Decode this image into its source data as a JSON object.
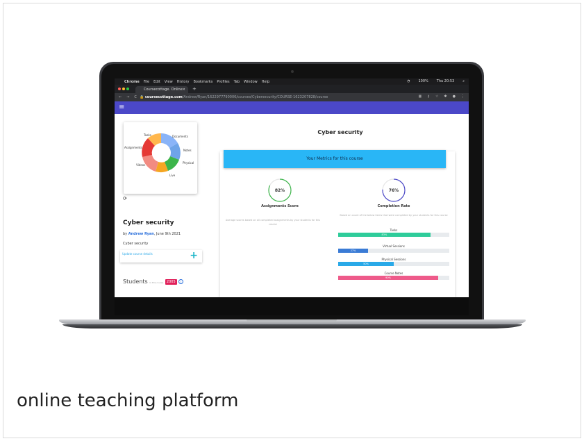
{
  "caption": "online teaching platform",
  "menubar": {
    "app": "Chrome",
    "items": [
      "File",
      "Edit",
      "View",
      "History",
      "Bookmarks",
      "Profiles",
      "Tab",
      "Window",
      "Help"
    ],
    "battery": "100%",
    "clock": "Thu 20:53"
  },
  "tab": {
    "title": "Coursecottage. Online teachi",
    "close": "×",
    "new": "+"
  },
  "url": {
    "host": "coursecottage.com",
    "path": "/Andrew/Ryan/1622977790006/courses/Cybersecurity/COURSE-1623207828/course"
  },
  "sidebar": {
    "chart_labels": [
      "Tasks",
      "Documents",
      "Assignments",
      "Notes",
      "Physical",
      "Videos",
      "Live"
    ],
    "course_title": "Cyber security",
    "by": "by",
    "author": "Andrew Ryan",
    "date": ", June 9th 2021",
    "subtitle": "Cyber security",
    "update_link": "Update course details",
    "plus": "+",
    "students_label": "Students",
    "students_small": "in this course",
    "students_count": "2005",
    "info": "i",
    "refresh": "⟳"
  },
  "main": {
    "title": "Cyber security",
    "banner": "Your Metrics for this course",
    "assignments": {
      "value_text": "82%",
      "value": 0.82,
      "label": "Assignments Score",
      "desc": "Average scores based on all completed assignments by your students for this course",
      "color": "#3cb54a"
    },
    "completion": {
      "value_text": "76%",
      "value": 0.76,
      "label": "Completion Rate",
      "desc": "Based on count of the below items that were completed by your students for this course",
      "color": "#4b48c8"
    },
    "bars": [
      {
        "label": "Tasks",
        "text": "83%",
        "value": 0.83,
        "color": "#2ecc9a"
      },
      {
        "label": "Virtual Sessions",
        "text": "27%",
        "value": 0.27,
        "color": "#3a7bd5"
      },
      {
        "label": "Physical Sessions",
        "text": "50%",
        "value": 0.5,
        "color": "#29a9e8"
      },
      {
        "label": "Course Notes",
        "text": "90%",
        "value": 0.9,
        "color": "#ee5a8a"
      }
    ]
  }
}
